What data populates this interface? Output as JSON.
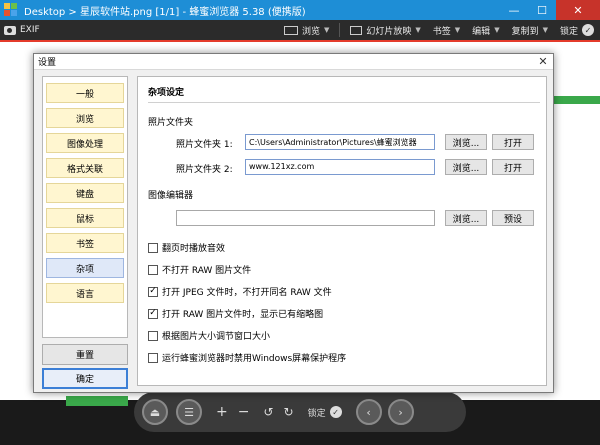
{
  "window": {
    "title": "Desktop > 星辰软件站.png [1/1] - 蜂蜜浏览器 5.38 (便携版)",
    "minimize": "—",
    "maximize": "☐",
    "close": "✕"
  },
  "toolbar": {
    "exif": "EXIF",
    "browse": "浏览",
    "slideshow": "幻灯片放映",
    "bookmarks": "书签",
    "edit": "编辑",
    "copy_to": "复制到",
    "lock": "锁定"
  },
  "controls": {
    "lock": "锁定",
    "plus": "+",
    "minus": "−"
  },
  "dialog": {
    "title": "设置",
    "close": "✕",
    "nav": [
      "一般",
      "浏览",
      "图像处理",
      "格式关联",
      "键盘",
      "鼠标",
      "书签",
      "杂项",
      "语言"
    ],
    "active_nav": 7,
    "reset": "重置",
    "ok": "确定",
    "section_title": "杂项设定",
    "photo_folder_group": "照片文件夹",
    "folder1_label": "照片文件夹 1:",
    "folder1_value": "C:\\Users\\Administrator\\Pictures\\蜂蜜浏览器",
    "folder2_label": "照片文件夹 2:",
    "folder2_value": "www.121xz.com",
    "browse_btn": "浏览...",
    "open_btn": "打开",
    "editor_group": "图像编辑器",
    "editor_value": "",
    "preset_btn": "预设",
    "options": [
      {
        "label": "翻页时播放音效",
        "checked": false
      },
      {
        "label": "不打开 RAW 图片文件",
        "checked": false
      },
      {
        "label": "打开 JPEG 文件时，不打开同名 RAW 文件",
        "checked": true
      },
      {
        "label": "打开 RAW 图片文件时，显示已有缩略图",
        "checked": true
      },
      {
        "label": "根据图片大小调节窗口大小",
        "checked": false
      },
      {
        "label": "运行蜂蜜浏览器时禁用Windows屏幕保护程序",
        "checked": false
      }
    ]
  },
  "colors": {
    "titlebar": "#1e8ed6",
    "toolbar": "#2b2b2b",
    "accent_green": "#3aa84a",
    "nav_item": "#fff6d0",
    "nav_active": "#dfe8f8"
  }
}
